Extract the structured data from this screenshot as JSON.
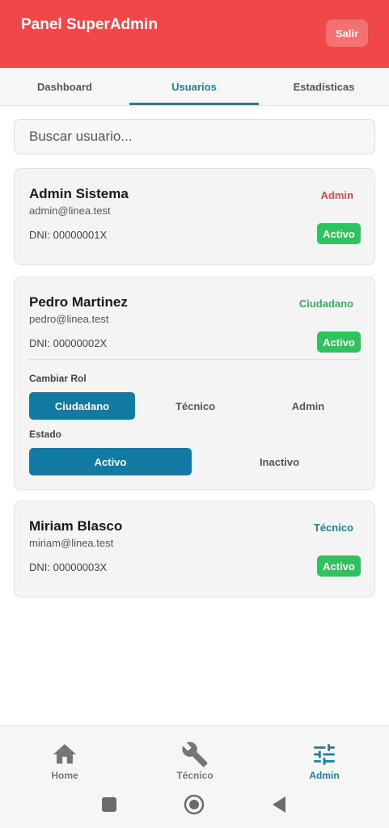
{
  "header": {
    "title": "Panel SuperAdmin",
    "logout_label": "Salir"
  },
  "tabs": [
    {
      "label": "Dashboard"
    },
    {
      "label": "Usuarios",
      "active": true
    },
    {
      "label": "Estadísticas"
    }
  ],
  "search": {
    "placeholder": "Buscar usuario..."
  },
  "users": [
    {
      "name": "Admin Sistema",
      "email": "admin@linea.test",
      "role": "Admin",
      "dni": "DNI: 00000001X",
      "status": "Activo"
    },
    {
      "name": "Pedro Martinez",
      "email": "pedro@linea.test",
      "role": "Ciudadano",
      "dni": "DNI: 00000002X",
      "status": "Activo",
      "expanded": {
        "change_role_label": "Cambiar Rol",
        "role_options": [
          "Ciudadano",
          "Técnico",
          "Admin"
        ],
        "selected_role": "Ciudadano",
        "state_label": "Estado",
        "state_options": [
          "Activo",
          "Inactivo"
        ],
        "selected_state": "Activo"
      }
    },
    {
      "name": "Miriam Blasco",
      "email": "miriam@linea.test",
      "role": "Técnico",
      "dni": "DNI: 00000003X",
      "status": "Activo"
    }
  ],
  "bottom_nav": [
    {
      "label": "Home",
      "icon": "home-icon"
    },
    {
      "label": "Técnico",
      "icon": "wrench-icon"
    },
    {
      "label": "Admin",
      "icon": "sliders-icon",
      "active": true
    }
  ],
  "system_nav": {
    "icons": [
      "recents-icon",
      "home-circle-icon",
      "back-icon"
    ]
  },
  "colors": {
    "header": "#f04848",
    "accent": "#1d7ea0",
    "status_active": "#2fc25e",
    "role_admin": "#e04848",
    "role_ciudadano": "#2fb25c",
    "role_tecnico": "#1d7ea0"
  }
}
